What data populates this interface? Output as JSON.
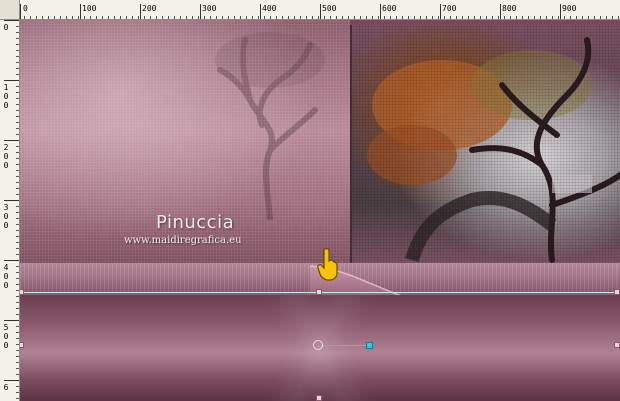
{
  "ruler": {
    "top_numbers": [
      "0",
      "100",
      "200",
      "300",
      "400",
      "500",
      "600",
      "700",
      "800",
      "900"
    ],
    "left_numbers": [
      "0",
      "1\n0\n0",
      "2\n0\n0",
      "3\n0\n0",
      "4\n0\n0",
      "5\n0\n0",
      "6"
    ]
  },
  "artwork": {
    "brand_title": "Pinuccia",
    "brand_url": "www.maidiregrafica.eu"
  },
  "icons": {
    "pointer": "pointing-hand-icon",
    "pivot": "pivot-point-icon",
    "rotation": "rotation-handle-icon"
  },
  "colors": {
    "canvas_mauve": "#8e5e70",
    "guide_cyan": "#3cc8d8",
    "hand_yellow": "#f5c400"
  }
}
